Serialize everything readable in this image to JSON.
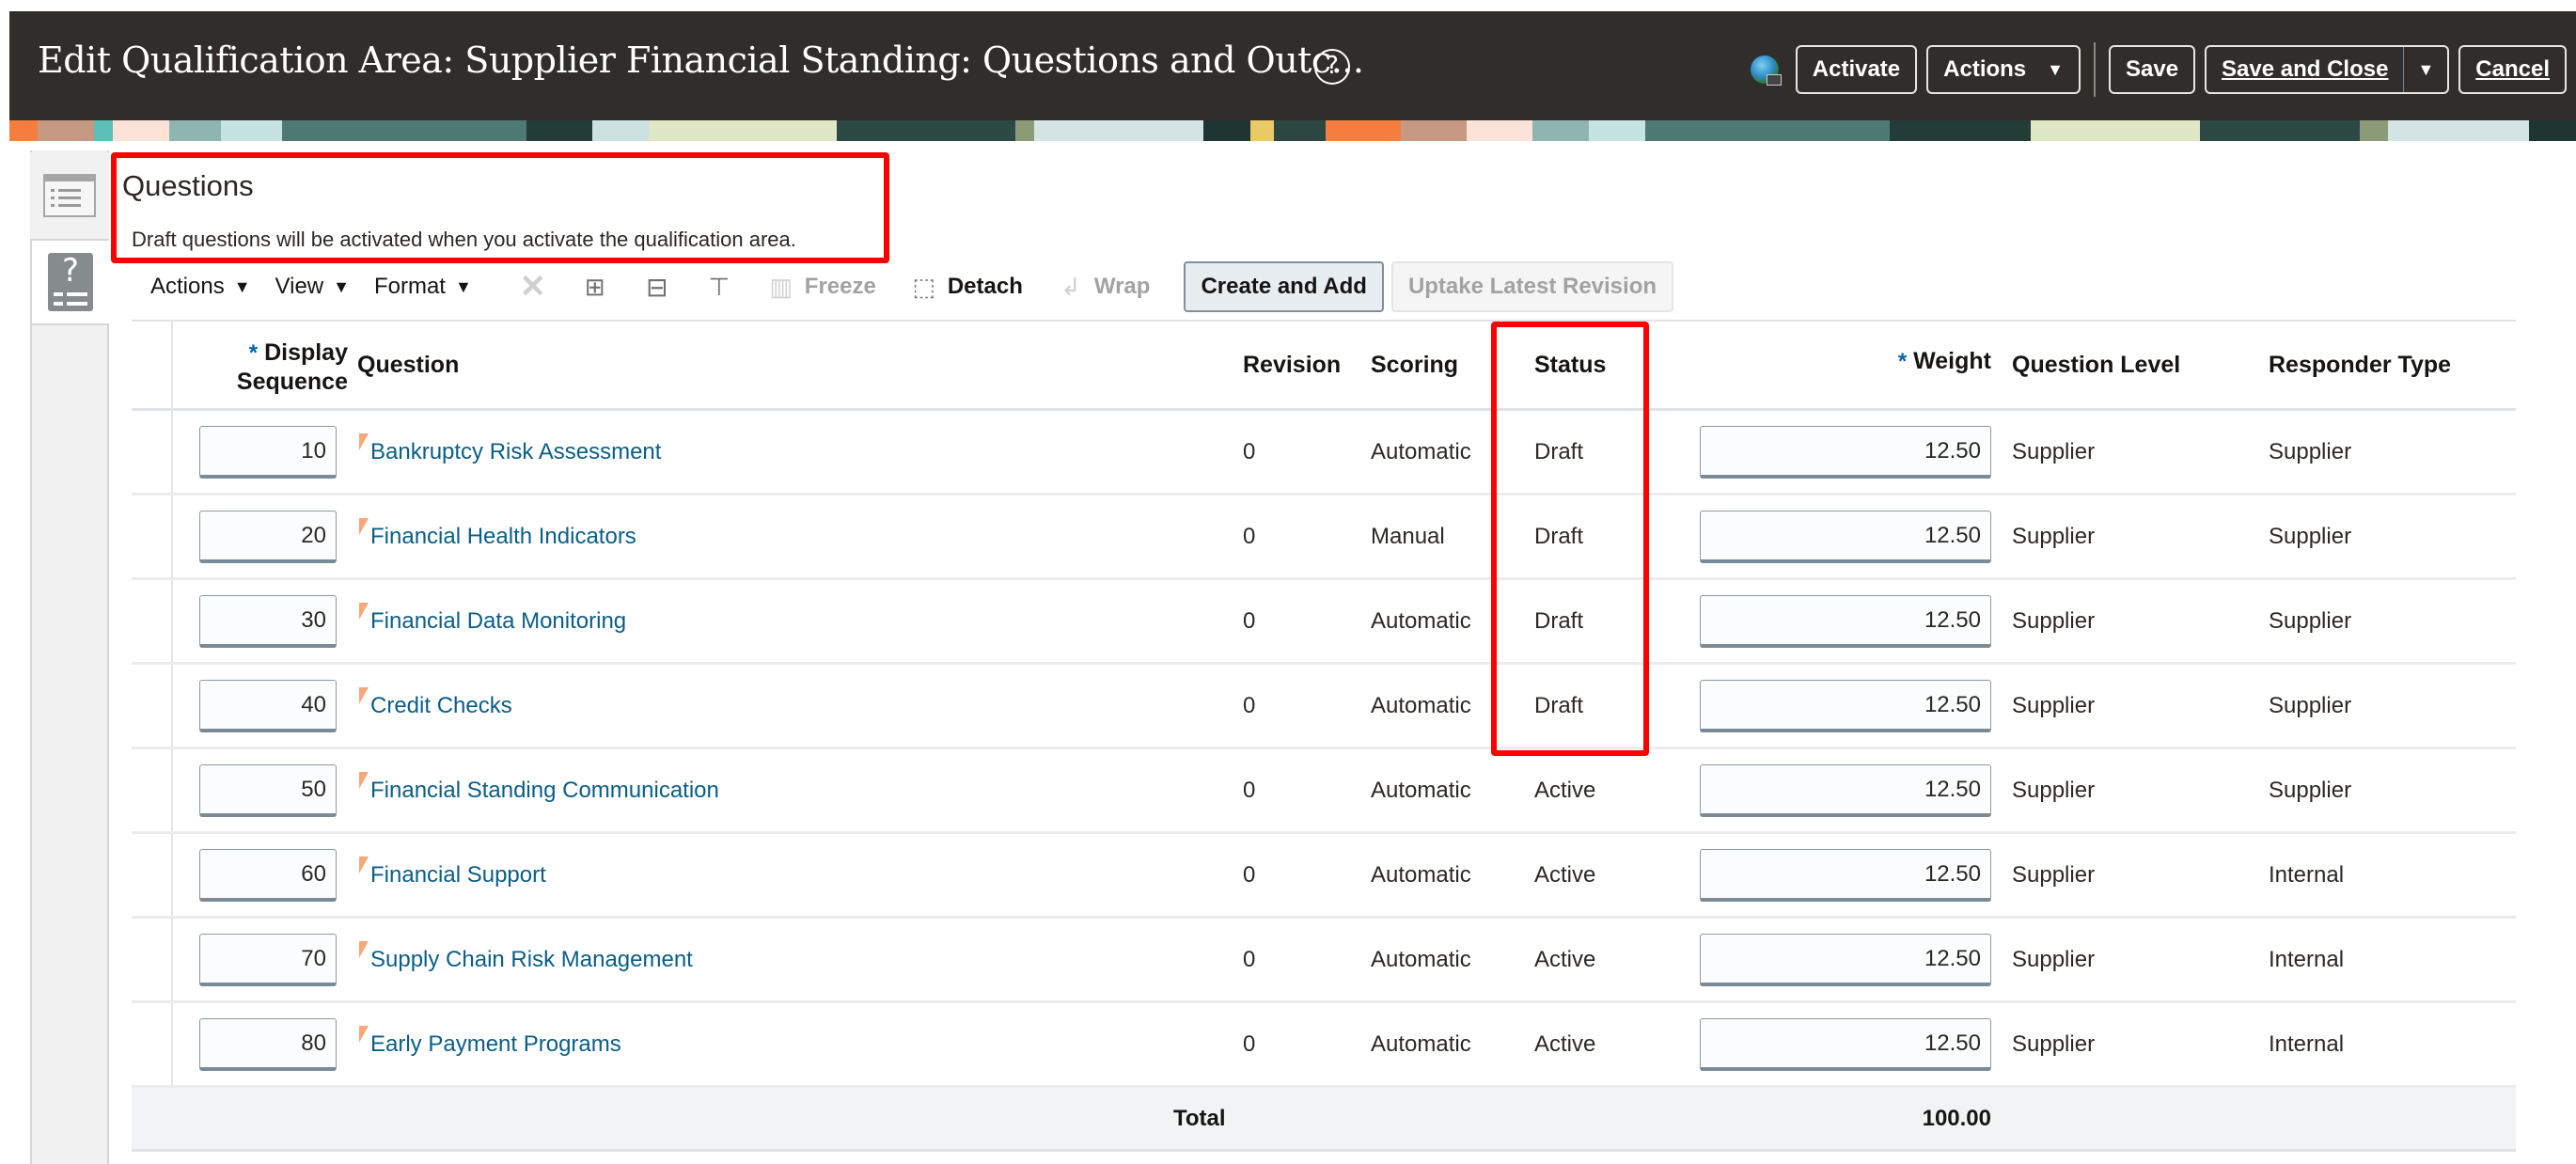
{
  "header": {
    "title": "Edit Qualification Area: Supplier Financial Standing: Questions and Outc...",
    "help_icon": "help-circle-icon",
    "globe_icon": "globe-network-icon",
    "buttons": {
      "activate": "Activate",
      "actions": "Actions",
      "save": "Save",
      "save_and_close": "Save and Close",
      "cancel": "Cancel"
    }
  },
  "side_tabs": [
    {
      "icon": "list-panel-icon"
    },
    {
      "icon": "question-list-icon"
    }
  ],
  "section": {
    "title": "Questions",
    "note": "Draft questions will be activated when you activate the qualification area."
  },
  "toolbar": {
    "actions": "Actions",
    "view": "View",
    "format": "Format",
    "freeze": "Freeze",
    "detach": "Detach",
    "wrap": "Wrap",
    "create_and_add": "Create and Add",
    "uptake_latest_revision": "Uptake Latest Revision"
  },
  "table": {
    "columns": {
      "display_sequence_line1": "Display",
      "display_sequence_line2": "Sequence",
      "question": "Question",
      "revision": "Revision",
      "scoring": "Scoring",
      "status": "Status",
      "weight": "Weight",
      "question_level": "Question Level",
      "responder_type": "Responder Type",
      "required_marker": "*"
    },
    "rows": [
      {
        "seq": "10",
        "question": "Bankruptcy Risk Assessment",
        "revision": "0",
        "scoring": "Automatic",
        "status": "Draft",
        "weight": "12.50",
        "level": "Supplier",
        "responder": "Supplier"
      },
      {
        "seq": "20",
        "question": "Financial Health Indicators",
        "revision": "0",
        "scoring": "Manual",
        "status": "Draft",
        "weight": "12.50",
        "level": "Supplier",
        "responder": "Supplier"
      },
      {
        "seq": "30",
        "question": "Financial Data Monitoring",
        "revision": "0",
        "scoring": "Automatic",
        "status": "Draft",
        "weight": "12.50",
        "level": "Supplier",
        "responder": "Supplier"
      },
      {
        "seq": "40",
        "question": "Credit Checks",
        "revision": "0",
        "scoring": "Automatic",
        "status": "Draft",
        "weight": "12.50",
        "level": "Supplier",
        "responder": "Supplier"
      },
      {
        "seq": "50",
        "question": "Financial Standing Communication",
        "revision": "0",
        "scoring": "Automatic",
        "status": "Active",
        "weight": "12.50",
        "level": "Supplier",
        "responder": "Supplier"
      },
      {
        "seq": "60",
        "question": "Financial Support",
        "revision": "0",
        "scoring": "Automatic",
        "status": "Active",
        "weight": "12.50",
        "level": "Supplier",
        "responder": "Internal"
      },
      {
        "seq": "70",
        "question": "Supply Chain Risk Management",
        "revision": "0",
        "scoring": "Automatic",
        "status": "Active",
        "weight": "12.50",
        "level": "Supplier",
        "responder": "Internal"
      },
      {
        "seq": "80",
        "question": "Early Payment Programs",
        "revision": "0",
        "scoring": "Automatic",
        "status": "Active",
        "weight": "12.50",
        "level": "Supplier",
        "responder": "Internal"
      }
    ],
    "total_label": "Total",
    "total_weight": "100.00"
  },
  "annotations": {
    "highlight_color": "#ff0000"
  }
}
